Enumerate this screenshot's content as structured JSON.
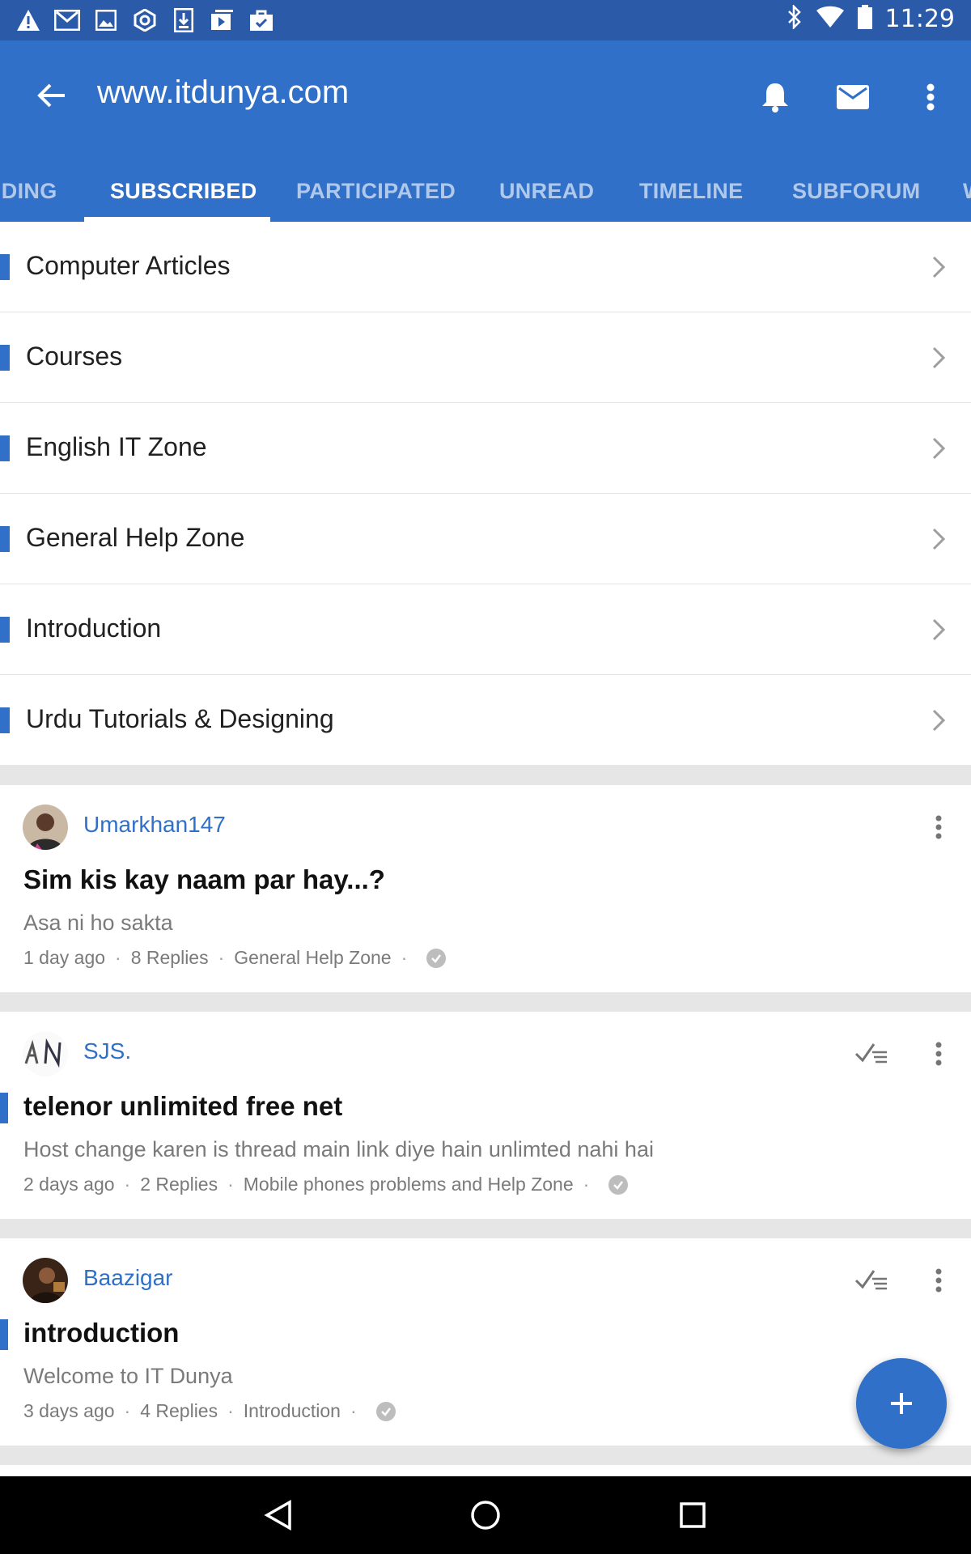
{
  "status_bar": {
    "time": "11:29",
    "left_icons": [
      "warning-icon",
      "gmail-icon",
      "image-icon",
      "target-icon",
      "download-icon",
      "video-icon",
      "store-icon"
    ],
    "right_icons": [
      "bluetooth-icon",
      "wifi-icon",
      "battery-icon"
    ]
  },
  "app_bar": {
    "title": "www.itdunya.com",
    "actions": [
      "bell-icon",
      "mail-icon",
      "overflow-menu-icon"
    ]
  },
  "tabs": [
    {
      "label": "IDING",
      "active": false
    },
    {
      "label": "SUBSCRIBED",
      "active": true
    },
    {
      "label": "PARTICIPATED",
      "active": false
    },
    {
      "label": "UNREAD",
      "active": false
    },
    {
      "label": "TIMELINE",
      "active": false
    },
    {
      "label": "SUBFORUM",
      "active": false
    },
    {
      "label": "W",
      "active": false
    }
  ],
  "forums": [
    {
      "label": "Computer Articles"
    },
    {
      "label": "Courses"
    },
    {
      "label": "English IT Zone"
    },
    {
      "label": "General Help Zone"
    },
    {
      "label": "Introduction"
    },
    {
      "label": "Urdu Tutorials & Designing"
    }
  ],
  "topics": [
    {
      "author": "Umarkhan147",
      "title": "Sim kis kay naam par hay...?",
      "snippet": "Asa ni ho sakta",
      "time": "1 day ago",
      "replies": "8 Replies",
      "forum": "General Help Zone",
      "unread": false,
      "mark_read_icon": false
    },
    {
      "author": "SJS.",
      "title": "telenor unlimited free net",
      "snippet": "Host change karen is thread main link diye hain unlimted nahi hai",
      "time": "2 days ago",
      "replies": "2 Replies",
      "forum": "Mobile phones problems and Help Zone",
      "unread": true,
      "mark_read_icon": true
    },
    {
      "author": "Baazigar",
      "title": "introduction",
      "snippet": "Welcome to IT Dunya",
      "time": "3 days ago",
      "replies": "4 Replies",
      "forum": "Introduction",
      "unread": true,
      "mark_read_icon": true
    }
  ],
  "colors": {
    "status_bar": "#2a5aa8",
    "app_bar": "#3070c8",
    "accent": "#3070c8",
    "background": "#e6e6e6"
  }
}
